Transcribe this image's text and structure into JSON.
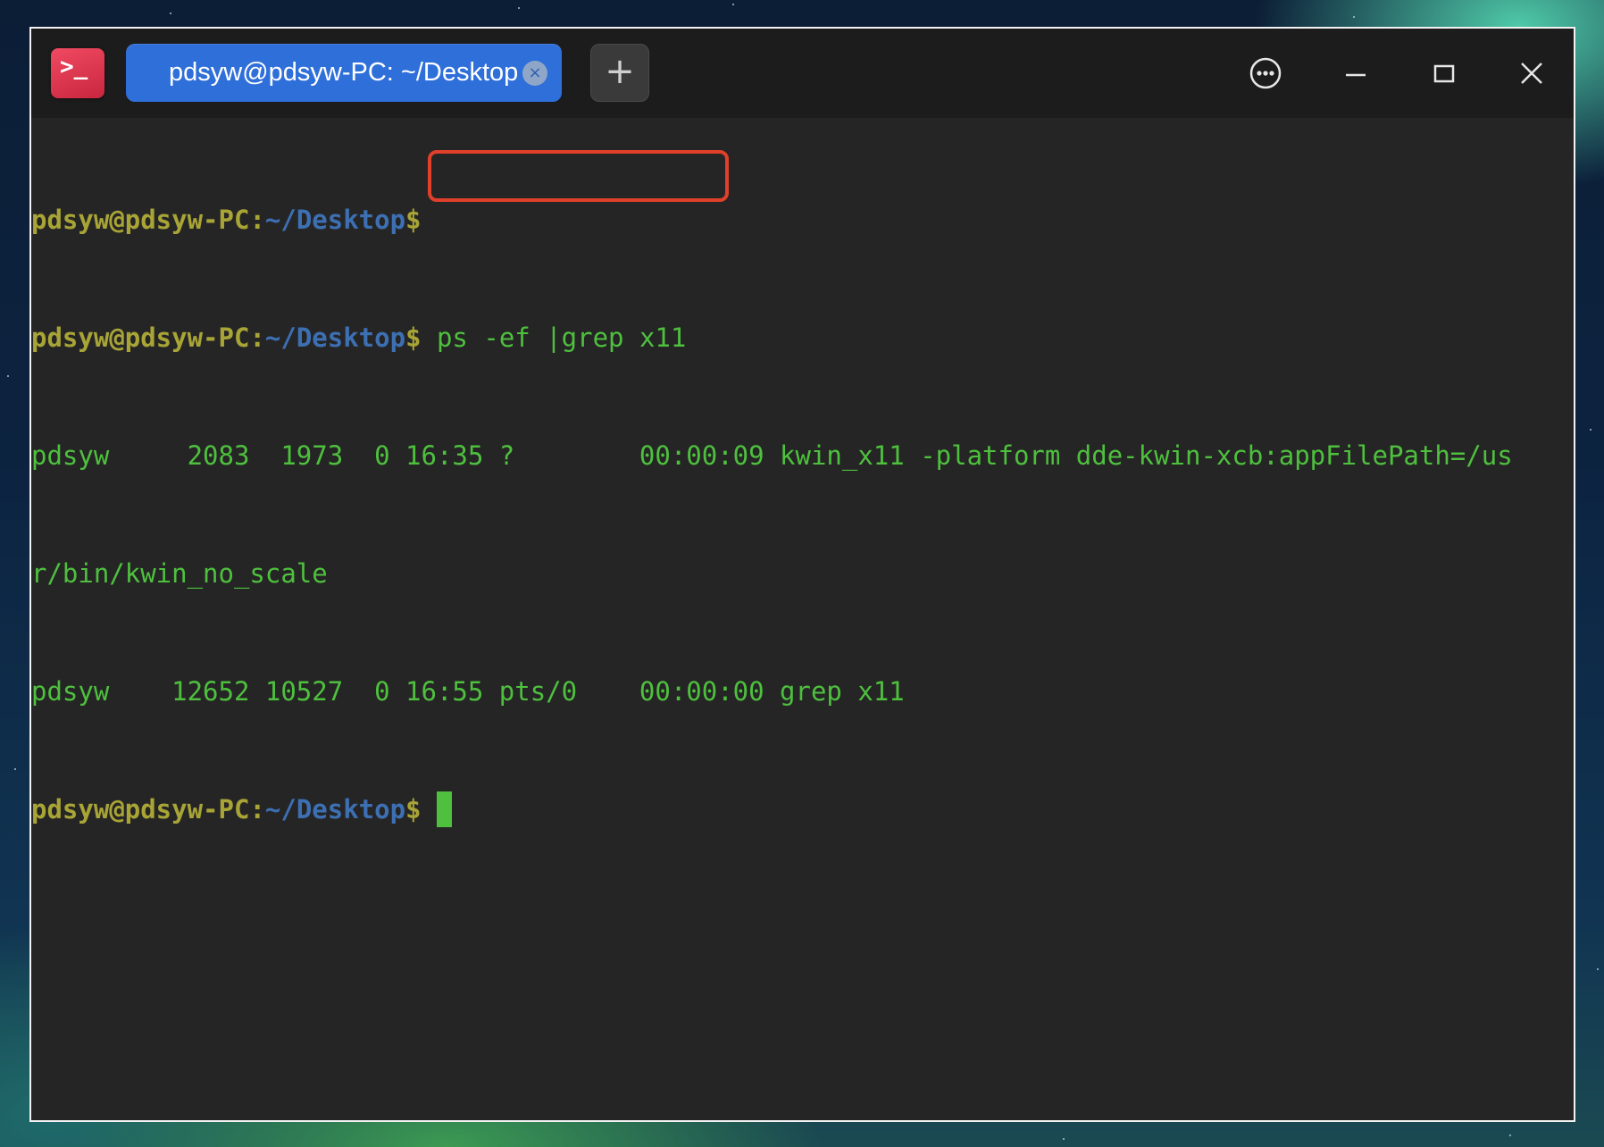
{
  "window": {
    "app_icon_glyph": ">_",
    "tab_title": "pdsyw@pdsyw-PC: ~/Desktop",
    "tab_close_glyph": "×",
    "new_tab_glyph": "+"
  },
  "prompt": {
    "user_host": "pdsyw@pdsyw-PC",
    "separator": ":",
    "path": "~/Desktop",
    "symbol": "$"
  },
  "terminal": {
    "command": " ps -ef |grep x11",
    "output": [
      "pdsyw     2083  1973  0 16:35 ?        00:00:09 kwin_x11 -platform dde-kwin-xcb:appFilePath=/us",
      "r/bin/kwin_no_scale",
      "pdsyw    12652 10527  0 16:55 pts/0    00:00:00 grep x11"
    ]
  },
  "colors": {
    "terminal_bg": "#252525",
    "titlebar_bg": "#1c1c1c",
    "prompt_user": "#a8a436",
    "prompt_path": "#3d6fb3",
    "output_text": "#4ec03e",
    "tab_active": "#2f6fd9",
    "highlight_box": "#e0402a"
  },
  "icons": {
    "app": "terminal-icon",
    "menu": "more-options-icon",
    "minimize": "minimize-icon",
    "maximize": "maximize-icon",
    "close": "close-icon"
  }
}
